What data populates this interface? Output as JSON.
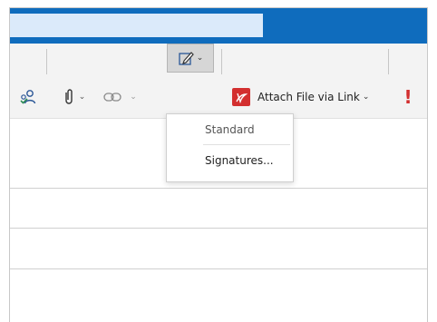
{
  "toolbar": {
    "attach_file_via_link_label": "Attach File via Link",
    "importance_glyph": "!"
  },
  "icons": {
    "check_names": "check-names-icon",
    "attach": "paperclip-icon",
    "link": "link-icon",
    "signature": "signature-pen-icon",
    "pdf": "adobe-pdf-icon",
    "importance": "high-importance-icon"
  },
  "signature_menu": {
    "items": [
      {
        "label": "Standard",
        "enabled": false
      },
      {
        "label": "Signatures...",
        "enabled": true
      }
    ]
  },
  "colors": {
    "titlebar": "#0f6cbd",
    "title_field": "#dbeafa",
    "toolbar_bg": "#f3f3f3",
    "pdf_red": "#d32f2f",
    "importance_red": "#d32f2f"
  }
}
